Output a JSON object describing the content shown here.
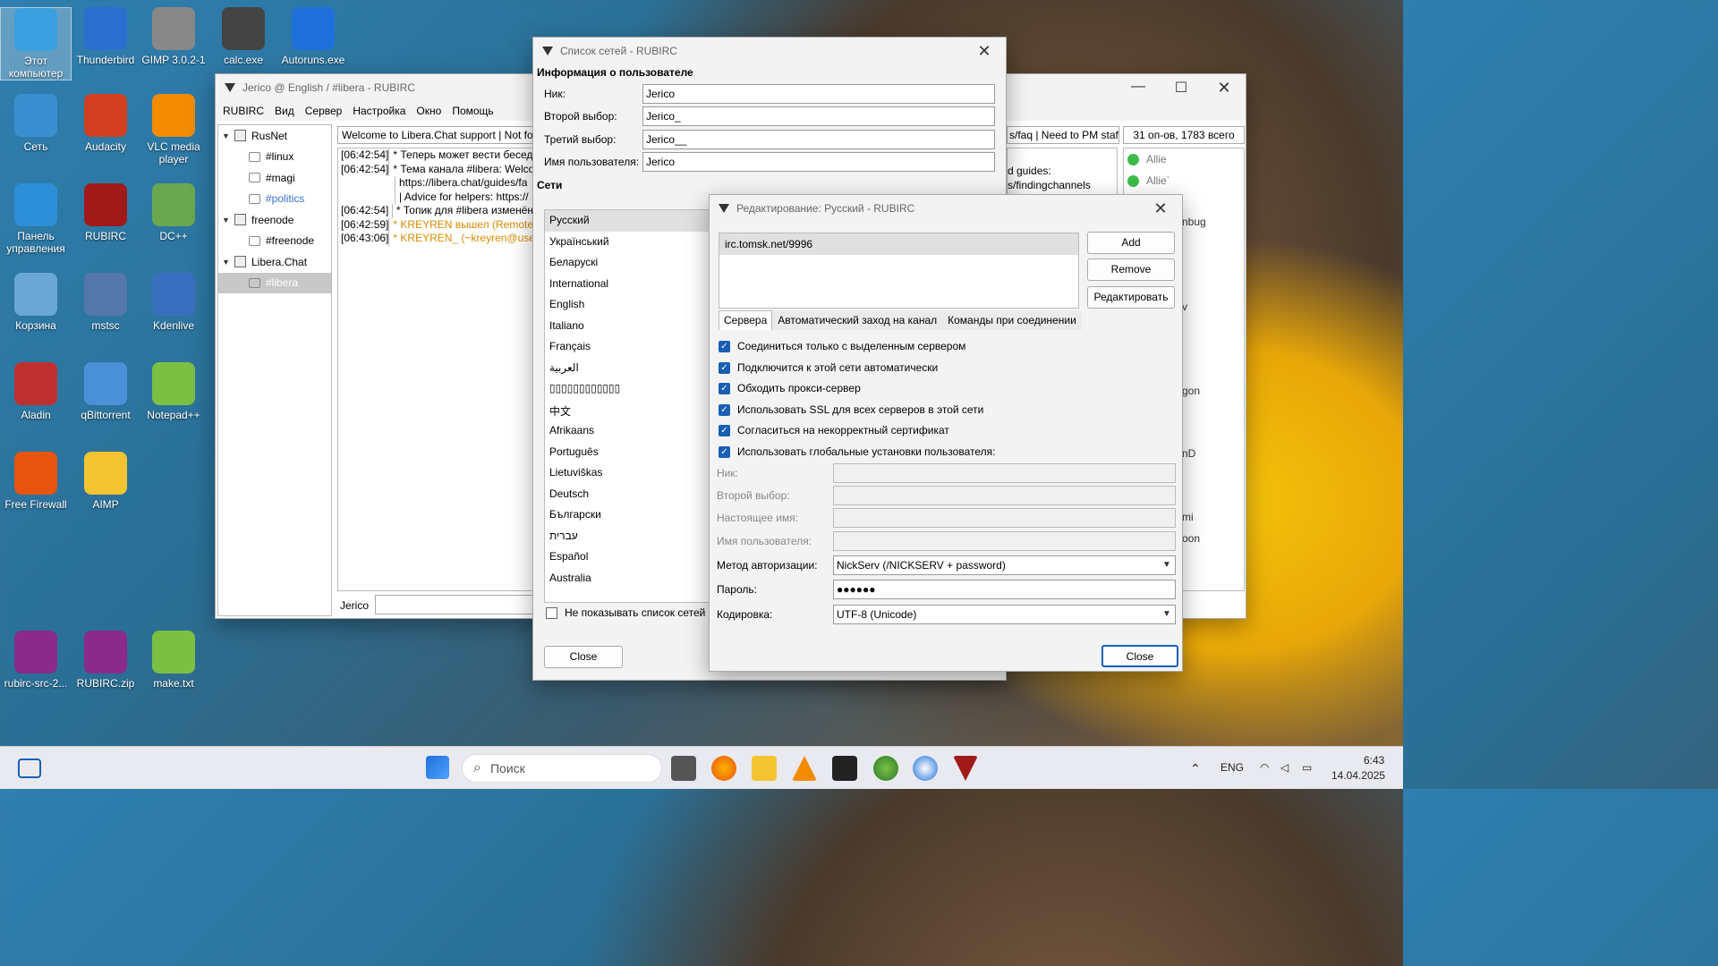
{
  "desktop_icons": [
    {
      "label": "Этот компьютер"
    },
    {
      "label": "Thunderbird"
    },
    {
      "label": "GIMP 3.0.2-1"
    },
    {
      "label": "calc.exe"
    },
    {
      "label": "Autoruns.exe"
    },
    {
      "label": "Сеть"
    },
    {
      "label": "Audacity"
    },
    {
      "label": "VLC media player"
    },
    {
      "label": "Панель управления"
    },
    {
      "label": "RUBIRC"
    },
    {
      "label": "DC++"
    },
    {
      "label": "Корзина"
    },
    {
      "label": "mstsc"
    },
    {
      "label": "Kdenlive"
    },
    {
      "label": "Aladin"
    },
    {
      "label": "qBittorrent"
    },
    {
      "label": "Notepad++"
    },
    {
      "label": "Free Firewall"
    },
    {
      "label": "AIMP"
    },
    {
      "label": "rubirc-src-2..."
    },
    {
      "label": "RUBIRC.zip"
    },
    {
      "label": "make.txt"
    }
  ],
  "main_window": {
    "title": "Jerico @ English / #libera - RUBIRC",
    "menu": [
      "RUBIRC",
      "Вид",
      "Сервер",
      "Настройка",
      "Окно",
      "Помощь"
    ],
    "tree": [
      {
        "label": "RusNet",
        "type": "server"
      },
      {
        "label": "#linux",
        "type": "channel"
      },
      {
        "label": "#magi",
        "type": "channel"
      },
      {
        "label": "#politics",
        "type": "channel"
      },
      {
        "label": "freenode",
        "type": "server"
      },
      {
        "label": "#freenode",
        "type": "channel"
      },
      {
        "label": "Libera.Chat",
        "type": "server"
      },
      {
        "label": "#libera",
        "type": "channel"
      }
    ],
    "topic": "Welcome to Libera.Chat support | Not fo",
    "topic_right": "s/faq | Need to PM staf",
    "ops_count": "31 оп-ов, 1783 всего",
    "chat": [
      {
        "ts": "[06:42:54]",
        "msg": "* Теперь может вести беседу"
      },
      {
        "ts": "[06:42:54]",
        "msg": "* Тема канала #libera: Welco"
      },
      {
        "ts": "",
        "msg": "https://libera.chat/guides/fa"
      },
      {
        "ts": "",
        "msg": "| Advice for helpers: https://"
      },
      {
        "ts": "[06:42:54]",
        "msg": "* Топик для #libera изменён"
      },
      {
        "ts": "[06:42:59]",
        "msg": "* KREYREN вышел (Remote h"
      },
      {
        "ts": "[06:43:06]",
        "msg": "* KREYREN_ (~kreyren@user/"
      }
    ],
    "chat_right": [
      "d guides:",
      "s/findingchannels"
    ],
    "users": [
      "Allie",
      "Allie`"
    ],
    "right_fragments": [
      "nbug",
      "v",
      "gon",
      "nD",
      "mi",
      "oon"
    ],
    "nick": "Jerico"
  },
  "netlist_dialog": {
    "title": "Список сетей - RUBIRC",
    "user_info_title": "Информация о пользователе",
    "fields": [
      {
        "label": "Ник:",
        "value": "Jerico"
      },
      {
        "label": "Второй выбор:",
        "value": "Jerico_"
      },
      {
        "label": "Третий выбор:",
        "value": "Jerico__"
      },
      {
        "label": "Имя пользователя:",
        "value": "Jerico"
      }
    ],
    "networks_title": "Сети",
    "networks": [
      "Русский",
      "Український",
      "Беларускі",
      "International",
      "English",
      "Italiano",
      "Français",
      "العربية",
      "▯▯▯▯▯▯▯▯▯▯▯▯",
      "中文",
      "Afrikaans",
      "Português",
      "Lietuviškas",
      "Deutsch",
      "Български",
      "עברית",
      "Español",
      "Australia"
    ],
    "dont_show_label": "Не показывать список сетей",
    "close_label": "Close"
  },
  "edit_dialog": {
    "title": "Редактирование: Русский - RUBIRC",
    "servers": [
      "irc.tomsk.net/9996"
    ],
    "add_label": "Add",
    "remove_label": "Remove",
    "edit_label": "Редактировать",
    "tabs": [
      "Сервера",
      "Автоматический заход на канал",
      "Команды при соединении"
    ],
    "options": [
      "Соединиться только с выделенным сервером",
      "Подключится к этой сети автоматически",
      "Обходить прокси-сервер",
      "Использовать SSL для всех серверов в этой сети",
      "Согласиться на некорректный сертификат",
      "Использовать глобальные установки пользователя:"
    ],
    "disabled_fields": [
      "Ник:",
      "Второй выбор:",
      "Настоящее имя:",
      "Имя пользователя:"
    ],
    "auth_label": "Метод авторизации:",
    "auth_value": "NickServ (/NICKSERV + password)",
    "password_label": "Пароль:",
    "password_value": "●●●●●●",
    "encoding_label": "Кодировка:",
    "encoding_value": "UTF-8 (Unicode)",
    "close_label": "Close"
  },
  "taskbar": {
    "search_placeholder": "Поиск",
    "lang": "ENG",
    "time": "6:43",
    "date": "14.04.2025"
  }
}
